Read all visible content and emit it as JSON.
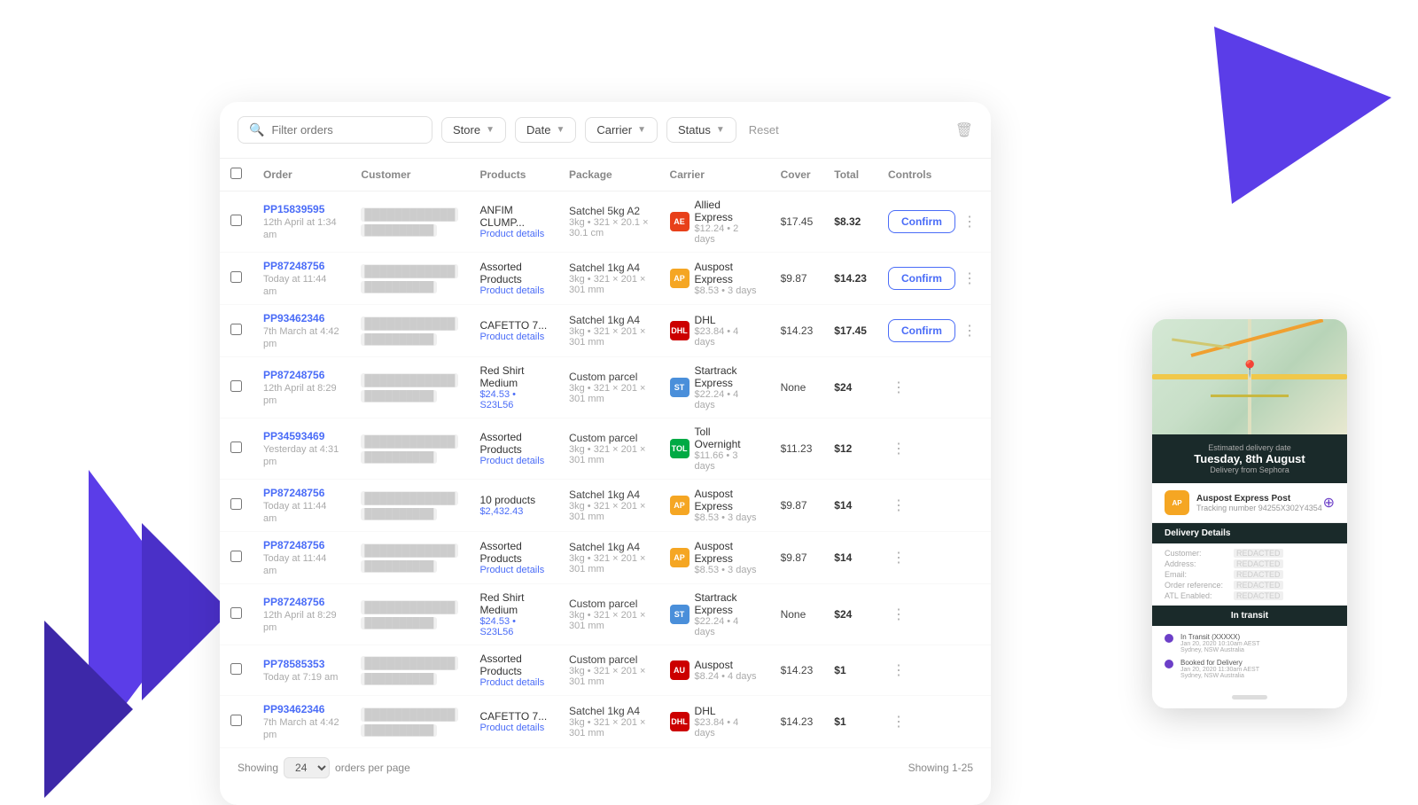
{
  "colors": {
    "purple": "#5b3de8",
    "accent": "#4a6cf7",
    "dark": "#1a2a2a"
  },
  "filters": {
    "search_placeholder": "Filter orders",
    "store_label": "Store",
    "date_label": "Date",
    "carrier_label": "Carrier",
    "status_label": "Status",
    "reset_label": "Reset"
  },
  "table": {
    "headers": [
      "",
      "Order",
      "Customer",
      "Products",
      "Package",
      "Carrier",
      "Cover",
      "Total",
      "Controls"
    ],
    "rows": [
      {
        "order_id": "PP15839595",
        "order_date": "12th April at 1:34 am",
        "customer_name": "REDACTED",
        "customer_addr": "REDACTED",
        "product_name": "ANFIM CLUMP...",
        "product_details": "Product details",
        "package": "Satchel 5kg A2",
        "package_dims": "3kg • 321 × 20.1 × 30.1 cm",
        "carrier_color": "#e8401a",
        "carrier_abbr": "AE",
        "carrier_name": "Allied Express",
        "carrier_price": "$12.24 • 2 days",
        "cover": "$17.45",
        "total": "$8.32",
        "has_confirm": true
      },
      {
        "order_id": "PP87248756",
        "order_date": "Today at 11:44 am",
        "customer_name": "REDACTED",
        "customer_addr": "REDACTED",
        "product_name": "Assorted Products",
        "product_details": "Product details",
        "package": "Satchel 1kg A4",
        "package_dims": "3kg • 321 × 201 × 301 mm",
        "carrier_color": "#f5a623",
        "carrier_abbr": "AP",
        "carrier_name": "Auspost Express",
        "carrier_price": "$8.53 • 3 days",
        "cover": "$9.87",
        "total": "$14.23",
        "has_confirm": true
      },
      {
        "order_id": "PP93462346",
        "order_date": "7th March at 4:42 pm",
        "customer_name": "REDACTED",
        "customer_addr": "REDACTED",
        "product_name": "CAFETTO 7...",
        "product_details": "Product details",
        "package": "Satchel 1kg A4",
        "package_dims": "3kg • 321 × 201 × 301 mm",
        "carrier_color": "#cc0000",
        "carrier_abbr": "DHL",
        "carrier_name": "DHL",
        "carrier_price": "$23.84 • 4 days",
        "cover": "$14.23",
        "total": "$17.45",
        "has_confirm": true
      },
      {
        "order_id": "PP87248756",
        "order_date": "12th April at 8:29 pm",
        "customer_name": "REDACTED",
        "customer_addr": "REDACTED",
        "product_name": "Red Shirt Medium",
        "product_details": "$24.53 • S23L56",
        "package": "Custom parcel",
        "package_dims": "3kg • 321 × 201 × 301 mm",
        "carrier_color": "#4a8fda",
        "carrier_abbr": "ST",
        "carrier_name": "Startrack Express",
        "carrier_price": "$22.24 • 4 days",
        "cover": "None",
        "total": "$24",
        "has_confirm": false
      },
      {
        "order_id": "PP34593469",
        "order_date": "Yesterday at 4:31 pm",
        "customer_name": "REDACTED",
        "customer_addr": "REDACTED",
        "product_name": "Assorted Products",
        "product_details": "Product details",
        "package": "Custom parcel",
        "package_dims": "3kg • 321 × 201 × 301 mm",
        "carrier_color": "#00aa44",
        "carrier_abbr": "TOLL",
        "carrier_name": "Toll Overnight",
        "carrier_price": "$11.66 • 3 days",
        "cover": "$11.23",
        "total": "$12",
        "has_confirm": false
      },
      {
        "order_id": "PP87248756",
        "order_date": "Today at 11:44 am",
        "customer_name": "REDACTED",
        "customer_addr": "REDACTED",
        "product_name": "10 products",
        "product_details": "$2,432.43",
        "package": "Satchel 1kg A4",
        "package_dims": "3kg • 321 × 201 × 301 mm",
        "carrier_color": "#f5a623",
        "carrier_abbr": "AP",
        "carrier_name": "Auspost Express",
        "carrier_price": "$8.53 • 3 days",
        "cover": "$9.87",
        "total": "$14",
        "has_confirm": false
      },
      {
        "order_id": "PP87248756",
        "order_date": "Today at 11:44 am",
        "customer_name": "REDACTED",
        "customer_addr": "REDACTED",
        "product_name": "Assorted Products",
        "product_details": "Product details",
        "package": "Satchel 1kg A4",
        "package_dims": "3kg • 321 × 201 × 301 mm",
        "carrier_color": "#f5a623",
        "carrier_abbr": "AP",
        "carrier_name": "Auspost Express",
        "carrier_price": "$8.53 • 3 days",
        "cover": "$9.87",
        "total": "$14",
        "has_confirm": false
      },
      {
        "order_id": "PP87248756",
        "order_date": "12th April at 8:29 pm",
        "customer_name": "REDACTED",
        "customer_addr": "REDACTED",
        "product_name": "Red Shirt Medium",
        "product_details": "$24.53 • S23L56",
        "package": "Custom parcel",
        "package_dims": "3kg • 321 × 201 × 301 mm",
        "carrier_color": "#4a8fda",
        "carrier_abbr": "ST",
        "carrier_name": "Startrack Express",
        "carrier_price": "$22.24 • 4 days",
        "cover": "None",
        "total": "$24",
        "has_confirm": false
      },
      {
        "order_id": "PP78585353",
        "order_date": "Today at 7:19 am",
        "customer_name": "REDACTED",
        "customer_addr": "REDACTED",
        "product_name": "Assorted Products",
        "product_details": "Product details",
        "package": "Custom parcel",
        "package_dims": "3kg • 321 × 201 × 301 mm",
        "carrier_color": "#cc0000",
        "carrier_abbr": "AU",
        "carrier_name": "Auspost",
        "carrier_price": "$8.24 • 4 days",
        "cover": "$14.23",
        "total": "$1",
        "has_confirm": false
      },
      {
        "order_id": "PP93462346",
        "order_date": "7th March at 4:42 pm",
        "customer_name": "REDACTED",
        "customer_addr": "REDACTED",
        "product_name": "CAFETTO 7...",
        "product_details": "Product details",
        "package": "Satchel 1kg A4",
        "package_dims": "3kg • 321 × 201 × 301 mm",
        "carrier_color": "#cc0000",
        "carrier_abbr": "DHL",
        "carrier_name": "DHL",
        "carrier_price": "$23.84 • 4 days",
        "cover": "$14.23",
        "total": "$1",
        "has_confirm": false
      }
    ]
  },
  "footer": {
    "showing_label": "Showing",
    "per_page": "24",
    "orders_per_page": "orders per page",
    "showing_range": "Showing 1-25"
  },
  "phone": {
    "delivery_label": "Estimated delivery date",
    "delivery_date": "Tuesday, 8th August",
    "delivery_from": "Delivery from Sephora",
    "carrier_name": "Auspost Express Post",
    "tracking_label": "Tracking number",
    "tracking_number": "94255X302Y4354",
    "section_delivery": "Delivery Details",
    "customer_label": "Customer:",
    "address_label": "Address:",
    "email_label": "Email:",
    "order_ref_label": "Order reference:",
    "atl_label": "ATL Enabled:",
    "section_transit": "In transit",
    "transit_events": [
      {
        "label": "In Transit (XXXXX)",
        "time": "Jan 20, 2020 10:10am AEST\nSydney, NSW Australia"
      },
      {
        "label": "Booked for Delivery",
        "time": "Jan 20, 2020 11:30am AEST\nSydney, NSW Australia"
      }
    ]
  },
  "buttons": {
    "confirm": "Confirm",
    "reset": "Reset"
  }
}
